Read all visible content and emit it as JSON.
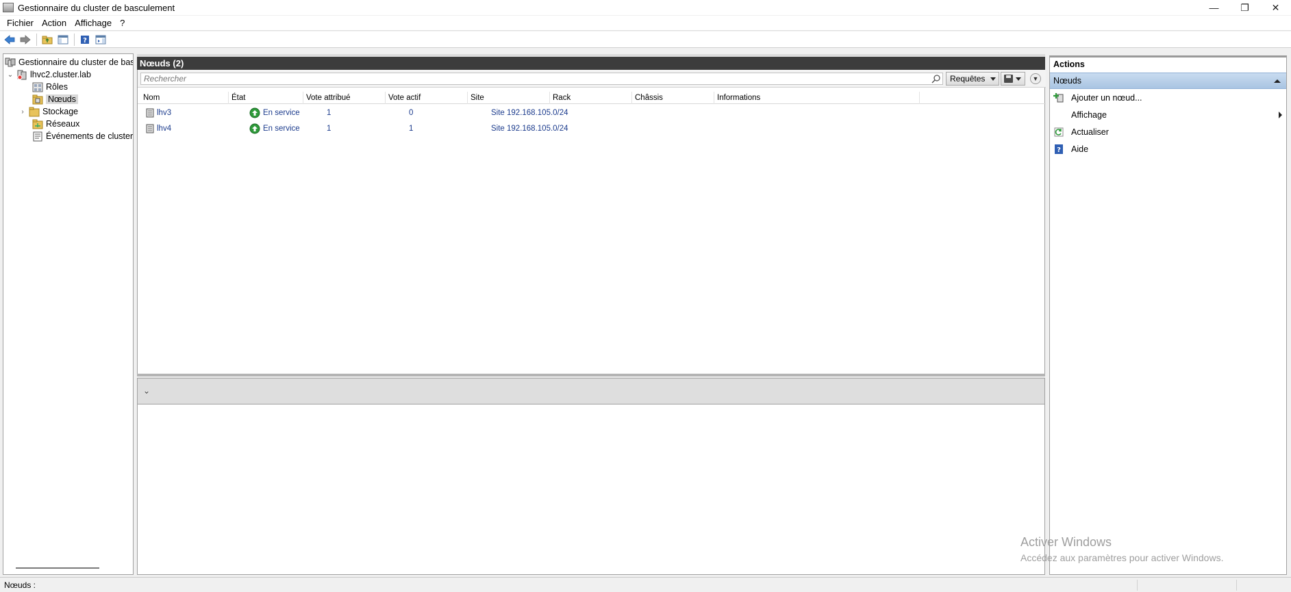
{
  "window": {
    "title": "Gestionnaire du cluster de basculement",
    "minimize": "—",
    "restore": "❐",
    "close": "✕"
  },
  "menu": [
    "Fichier",
    "Action",
    "Affichage",
    "?"
  ],
  "tree": {
    "root": "Gestionnaire du cluster de basculement",
    "cluster": "lhvc2.cluster.lab",
    "items": [
      "Rôles",
      "Nœuds",
      "Stockage",
      "Réseaux",
      "Événements de cluster"
    ],
    "selected": "Nœuds"
  },
  "center": {
    "header": "Nœuds (2)",
    "search_placeholder": "Rechercher",
    "requests_label": "Requêtes",
    "columns": [
      "Nom",
      "État",
      "Vote attribué",
      "Vote actif",
      "Site",
      "Rack",
      "Châssis",
      "Informations"
    ],
    "rows": [
      {
        "name": "lhv3",
        "state": "En service",
        "vote_assigned": "1",
        "vote_active": "0",
        "site": "Site 192.168.105.0/24",
        "rack": "",
        "chassis": "",
        "info": ""
      },
      {
        "name": "lhv4",
        "state": "En service",
        "vote_assigned": "1",
        "vote_active": "1",
        "site": "Site 192.168.105.0/24",
        "rack": "",
        "chassis": "",
        "info": ""
      }
    ],
    "detail_chevron": "⌄"
  },
  "actions": {
    "title": "Actions",
    "section": "Nœuds",
    "items": [
      "Ajouter un nœud...",
      "Affichage",
      "Actualiser",
      "Aide"
    ]
  },
  "watermark": {
    "line1": "Activer Windows",
    "line2": "Accédez aux paramètres pour activer Windows."
  },
  "status": {
    "text": "Nœuds :"
  },
  "colors": {
    "header_bg": "#3c3c3c",
    "link_text": "#1a3a8c",
    "section_bg": "#b8d0ea",
    "status_ok": "#2e9a3a"
  }
}
